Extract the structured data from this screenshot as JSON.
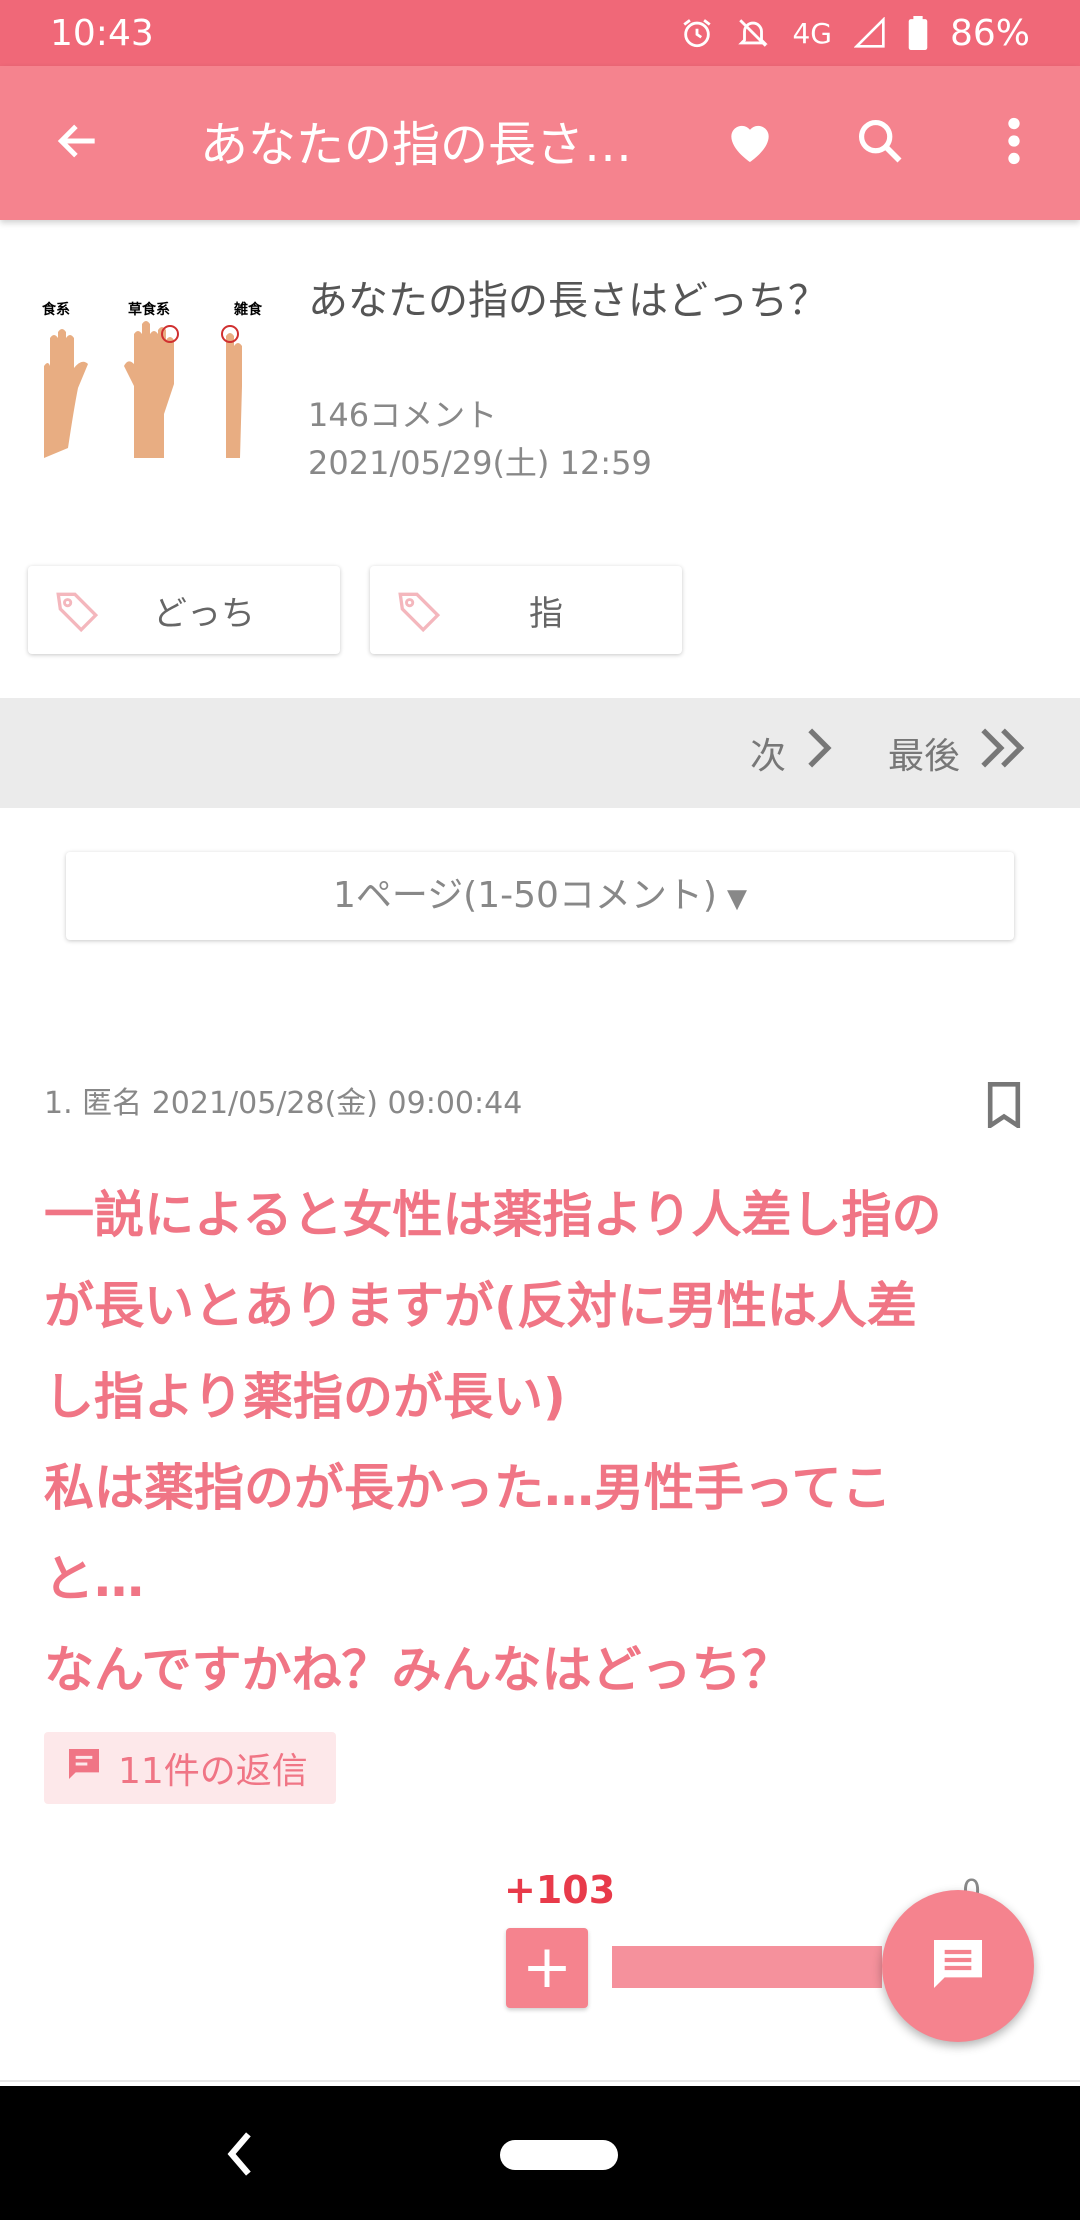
{
  "status_bar": {
    "time": "10:43",
    "network": "4G",
    "battery": "86%",
    "icons": [
      "alarm-icon",
      "bell-off-icon",
      "signal-icon",
      "battery-icon"
    ]
  },
  "app_bar": {
    "title": "あなたの指の長さはどっち？",
    "icons": [
      "back-arrow-icon",
      "heart-icon",
      "search-icon",
      "more-vert-icon"
    ]
  },
  "thread": {
    "title": "あなたの指の長さはどっち？",
    "comment_count": "146コメント",
    "date": "2021/05/29(土) 12:59",
    "thumbnail_labels": [
      "食系",
      "草食系",
      "雑食"
    ]
  },
  "tags": [
    {
      "label": "どっち"
    },
    {
      "label": "指"
    }
  ],
  "pager": {
    "next_label": "次",
    "last_label": "最後",
    "page_select": "1ページ(1-50コメント)",
    "page_select_arrow": "▼"
  },
  "comment": {
    "meta": "1. 匿名 2021/05/28(金) 09:00:44",
    "body": "一説によると女性は薬指より人差し指の\nが長いとありますが(反対に男性は人差\nし指より薬指のが長い)\n私は薬指のが長かった…男性手ってこ\nと…\nなんですかね？みんなはどっち？",
    "replies_label": "11件の返信",
    "score": "+103",
    "plus_label": "+",
    "minus_peek": "0"
  },
  "colors": {
    "status_bar": "#f06878",
    "app_bar": "#f5838e",
    "accent_text": "#f07585",
    "score": "#e83a4a",
    "reply_bg": "#fde8ea"
  }
}
